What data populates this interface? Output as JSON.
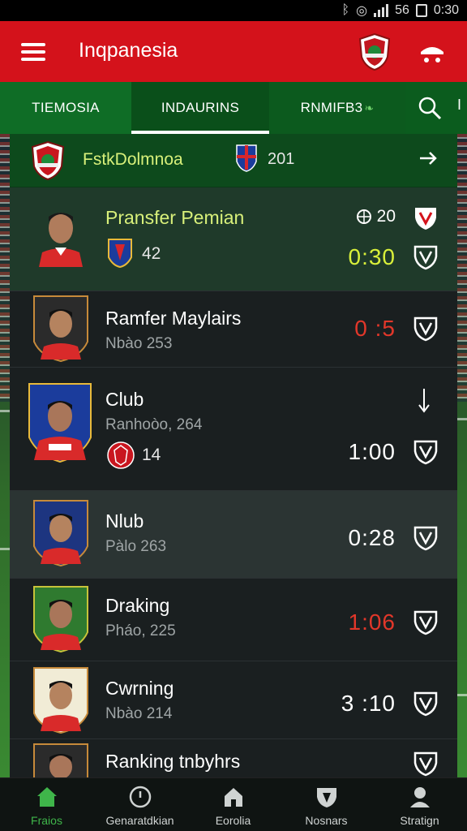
{
  "status_bar": {
    "time": "0:30",
    "network": "56"
  },
  "app_bar": {
    "title": "Inqpanesia"
  },
  "tabs": [
    {
      "label": "TIEMOSIA"
    },
    {
      "label": "INDAURINS"
    },
    {
      "label": "RNMIFB3",
      "suffix": "❧"
    }
  ],
  "tab_more": "I",
  "league": {
    "name": "FstkDolmnoa",
    "year": "201"
  },
  "players": [
    {
      "name": "Pransfer Pemian",
      "stat": "20",
      "badge_num": "42",
      "time": "0:30",
      "time_color": "yellow"
    },
    {
      "name": "Ramfer Maylairs",
      "sub": "Nbào 253",
      "time": "0 :5",
      "time_color": "red"
    },
    {
      "name": "Club",
      "sub": "Ranhoòo, 264",
      "badge_num": "14",
      "time": "1:00",
      "time_color": "white"
    },
    {
      "name": "Nlub",
      "sub": "Pàlo 263",
      "time": "0:28",
      "time_color": "white"
    },
    {
      "name": "Draking",
      "sub": "Pháo, 225",
      "time": "1:06",
      "time_color": "red"
    },
    {
      "name": "Cwrning",
      "sub": "Nbào 214",
      "time": "3 :10",
      "time_color": "white"
    },
    {
      "name": "Ranking tnbyhrs",
      "sub": "",
      "time": "",
      "time_color": "white"
    }
  ],
  "bottom_nav": [
    {
      "label": "Fraios",
      "icon": "home-icon",
      "active": true
    },
    {
      "label": "Genaratdkian",
      "icon": "clock-icon",
      "active": false
    },
    {
      "label": "Eorolia",
      "icon": "house-icon",
      "active": false
    },
    {
      "label": "Nosnars",
      "icon": "shield-icon",
      "active": false
    },
    {
      "label": "Stratign",
      "icon": "user-icon",
      "active": false
    }
  ],
  "colors": {
    "brand_red": "#d4121b",
    "brand_green": "#0b5c1e",
    "accent_yellow": "#d9f03a",
    "alert_red": "#e2372a",
    "active_nav": "#3fb54a"
  }
}
